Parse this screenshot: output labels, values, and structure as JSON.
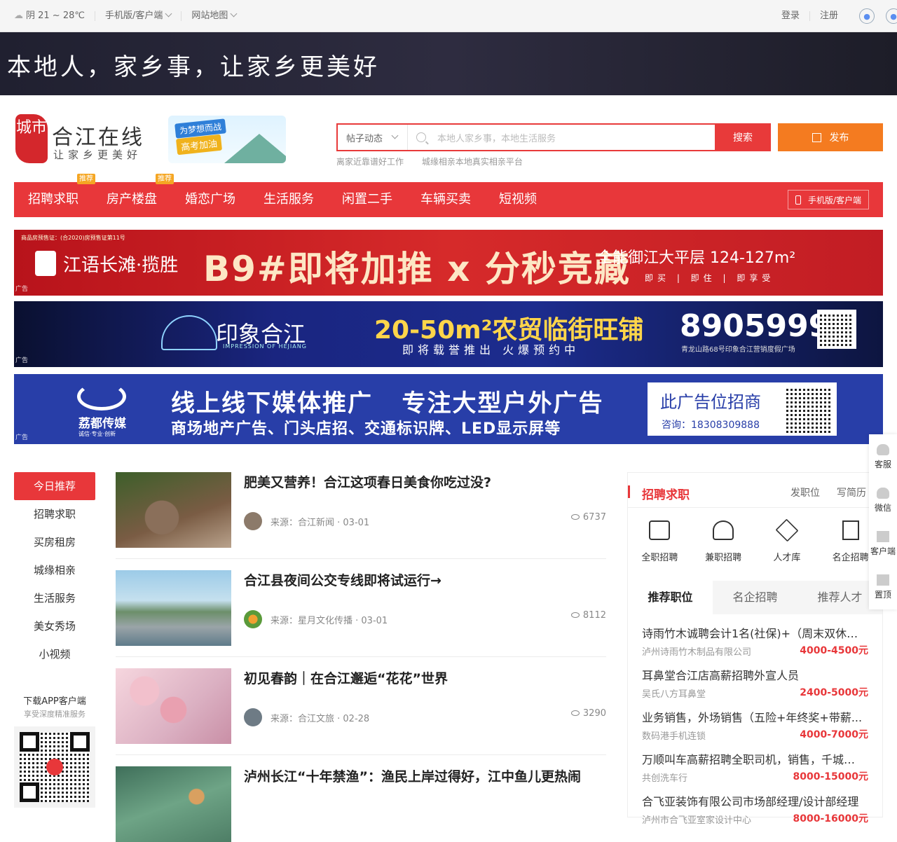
{
  "topbar": {
    "weather": "阴 21 ~ 28℃",
    "mobile": "手机版/客户端",
    "sitemap": "网站地图",
    "login": "登录",
    "register": "注册"
  },
  "hero": {
    "slogan": "本地人，家乡事，让家乡更美好"
  },
  "logo": {
    "seal": "城市",
    "name": "合江在线",
    "slogan": "让家乡更美好"
  },
  "promo": {
    "line1": "为梦想而战",
    "line2": "高考加油"
  },
  "search": {
    "category": "帖子动态",
    "placeholder": "本地人家乡事，本地生活服务",
    "button": "搜索",
    "hot": [
      "离家近靠谱好工作",
      "城缘相亲本地真实相亲平台"
    ]
  },
  "publish": "发布",
  "nav": {
    "items": [
      "招聘求职",
      "房产楼盘",
      "婚恋广场",
      "生活服务",
      "闲置二手",
      "车辆买卖",
      "短视频"
    ],
    "tag": "推荐",
    "app": "手机版/客户端"
  },
  "ads": {
    "label": "广告",
    "ad1": {
      "top": "商品房预售证：(合2020)房预售证第11号",
      "brand": "江语长滩·揽胜",
      "main": "B9#即将加推 x 分秒竞藏",
      "side": "全能御江大平层 124-127m²",
      "sub": "即买 | 即住 | 即享受"
    },
    "ad2": {
      "brand": "印象合江",
      "brand_en": "IMPRESSION OF HEJIANG",
      "main": "20-50m²农贸临街旺铺",
      "sub": "即将载誉推出 火爆预约中",
      "phone": "8905999",
      "addr": "青龙山路68号印象合江营销度假广场"
    },
    "ad3": {
      "brand": "荔都传媒",
      "brand_sub": "诚信·专业·创新",
      "main": "线上线下媒体推广   专注大型户外广告",
      "sub": "商场地产广告、门头店招、交通标识牌、LED显示屏等",
      "box_title": "此广告位招商",
      "box_phone": "咨询：18308309888"
    }
  },
  "leftnav": [
    "今日推荐",
    "招聘求职",
    "买房租房",
    "城缘相亲",
    "生活服务",
    "美女秀场",
    "小视频"
  ],
  "download": {
    "title": "下载APP客户端",
    "sub": "享受深度精准服务"
  },
  "news": [
    {
      "title": "肥美又营养！合江这项春日美食你吃过没?",
      "meta": "来源：合江新闻 · 03-01",
      "views": "6737"
    },
    {
      "title": "合江县夜间公交专线即将试运行→",
      "meta": "来源：星月文化传播 · 03-01",
      "views": "8112"
    },
    {
      "title": "初见春韵｜在合江邂逅“花花”世界",
      "meta": "来源：合江文旅 · 02-28",
      "views": "3290"
    },
    {
      "title": "泸州长江“十年禁渔”：渔民上岸过得好，江中鱼儿更热闹",
      "meta": "",
      "views": ""
    }
  ],
  "jobs": {
    "title": "招聘求职",
    "post": "发职位",
    "resume": "写简历",
    "cats": [
      "全职招聘",
      "兼职招聘",
      "人才库",
      "名企招聘"
    ],
    "tabs": [
      "推荐职位",
      "名企招聘",
      "推荐人才"
    ],
    "list": [
      {
        "title": "诗雨竹木诚聘会计1名(社保)+（周末双休）...",
        "company": "泸州诗雨竹木制品有限公司",
        "salary": "4000-4500元"
      },
      {
        "title": "耳鼻堂合江店高薪招聘外宣人员",
        "company": "吴氏八方耳鼻堂",
        "salary": "2400-5000元"
      },
      {
        "title": "业务销售，外场销售（五险+年终奖+带薪...",
        "company": "数码港手机连锁",
        "salary": "4000-7000元"
      },
      {
        "title": "万顺叫车高薪招聘全职司机，销售，千城万...",
        "company": "共创洗车行",
        "salary": "8000-15000元"
      },
      {
        "title": "合飞亚装饰有限公司市场部经理/设计部经理",
        "company": "泸州市合飞亚室家设计中心",
        "salary": "8000-16000元"
      }
    ]
  },
  "side": [
    "客服",
    "微信",
    "客户端",
    "置顶"
  ]
}
